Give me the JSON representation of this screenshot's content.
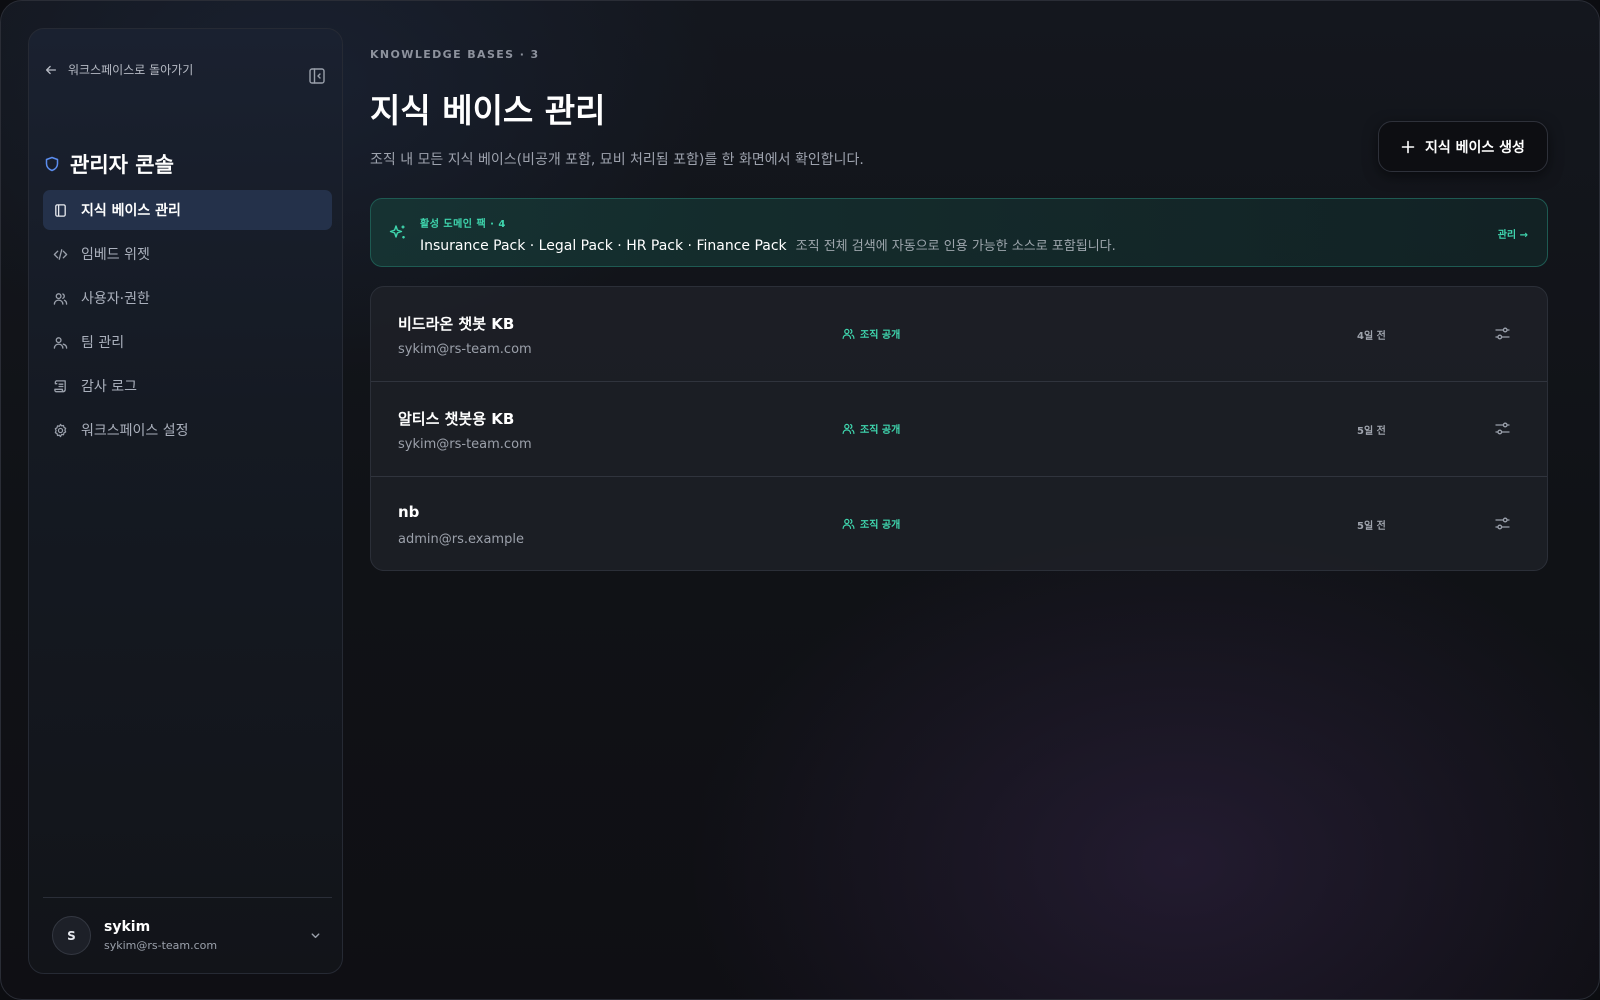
{
  "sidebar": {
    "back_label": "워크스페이스로 돌아가기",
    "console_title": "관리자 콘솔",
    "items": [
      {
        "label": "지식 베이스 관리",
        "icon": "book-icon",
        "active": true
      },
      {
        "label": "임베드 위젯",
        "icon": "code-icon",
        "active": false
      },
      {
        "label": "사용자·권한",
        "icon": "users-icon",
        "active": false
      },
      {
        "label": "팀 관리",
        "icon": "team-icon",
        "active": false
      },
      {
        "label": "감사 로그",
        "icon": "scroll-icon",
        "active": false
      },
      {
        "label": "워크스페이스 설정",
        "icon": "gear-icon",
        "active": false
      }
    ],
    "user": {
      "initial": "S",
      "name": "sykim",
      "email": "sykim@rs-team.com"
    }
  },
  "main": {
    "eyebrow": "KNOWLEDGE BASES · 3",
    "title": "지식 베이스 관리",
    "description": "조직 내 모든 지식 베이스(비공개 포함, 묘비 처리됨 포함)를 한 화면에서 확인합니다.",
    "create_button_label": "지식 베이스 생성"
  },
  "domain_packs": {
    "label": "활성 도메인 팩 · 4",
    "names": "Insurance Pack · Legal Pack · HR Pack · Finance Pack",
    "note": "조직 전체 검색에 자동으로 인용 가능한 소스로 포함됩니다.",
    "manage_label": "관리 →"
  },
  "knowledge_bases": [
    {
      "name": "비드라온 챗봇 KB",
      "owner": "sykim@rs-team.com",
      "visibility": "조직 공개",
      "updated": "4일 전"
    },
    {
      "name": "알티스 챗봇용 KB",
      "owner": "sykim@rs-team.com",
      "visibility": "조직 공개",
      "updated": "5일 전"
    },
    {
      "name": "nb",
      "owner": "admin@rs.example",
      "visibility": "조직 공개",
      "updated": "5일 전"
    }
  ],
  "colors": {
    "accent_teal": "#3fd6ae",
    "active_nav": "#24314a",
    "shield_blue": "#5b8def"
  }
}
